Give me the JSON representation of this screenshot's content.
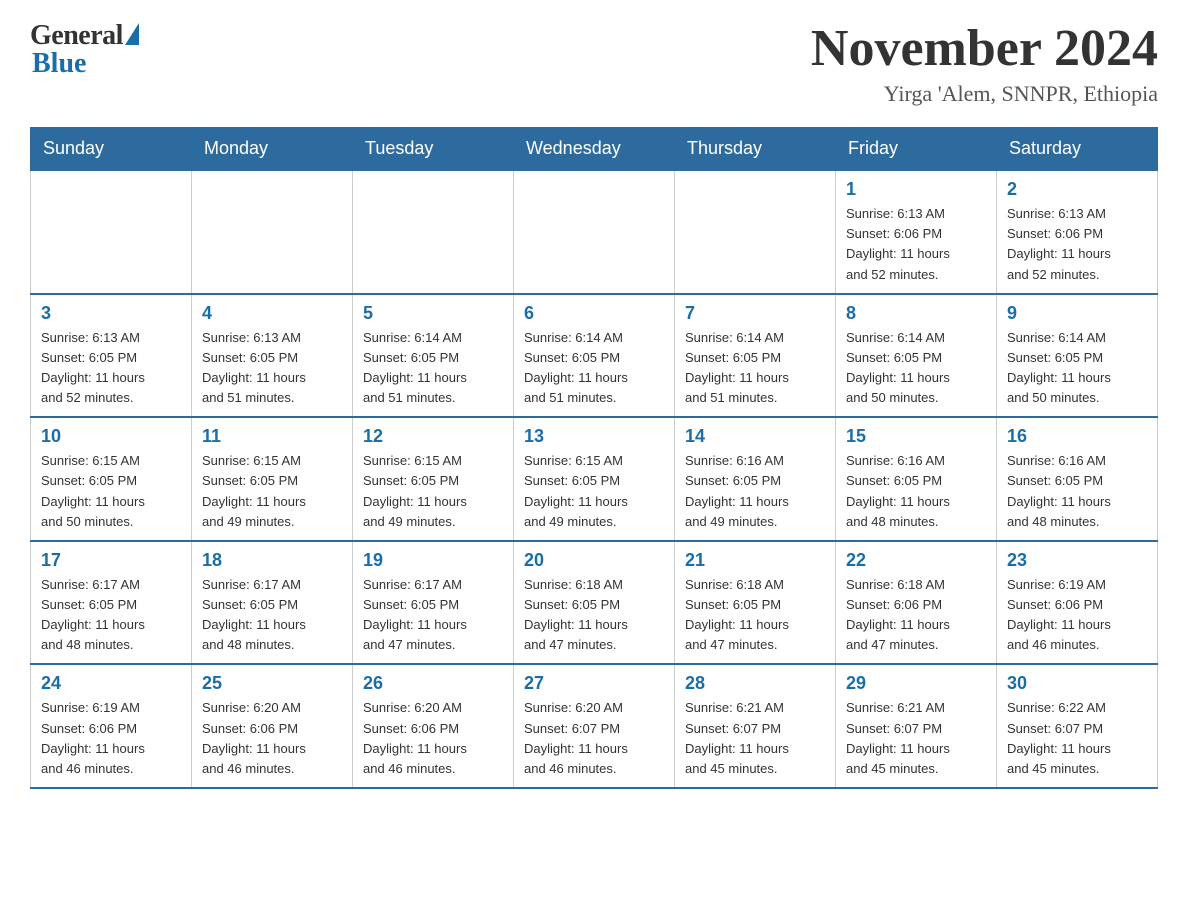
{
  "logo": {
    "general": "General",
    "blue": "Blue"
  },
  "header": {
    "title": "November 2024",
    "location": "Yirga 'Alem, SNNPR, Ethiopia"
  },
  "days_of_week": [
    "Sunday",
    "Monday",
    "Tuesday",
    "Wednesday",
    "Thursday",
    "Friday",
    "Saturday"
  ],
  "weeks": [
    [
      {
        "day": "",
        "info": ""
      },
      {
        "day": "",
        "info": ""
      },
      {
        "day": "",
        "info": ""
      },
      {
        "day": "",
        "info": ""
      },
      {
        "day": "",
        "info": ""
      },
      {
        "day": "1",
        "info": "Sunrise: 6:13 AM\nSunset: 6:06 PM\nDaylight: 11 hours\nand 52 minutes."
      },
      {
        "day": "2",
        "info": "Sunrise: 6:13 AM\nSunset: 6:06 PM\nDaylight: 11 hours\nand 52 minutes."
      }
    ],
    [
      {
        "day": "3",
        "info": "Sunrise: 6:13 AM\nSunset: 6:05 PM\nDaylight: 11 hours\nand 52 minutes."
      },
      {
        "day": "4",
        "info": "Sunrise: 6:13 AM\nSunset: 6:05 PM\nDaylight: 11 hours\nand 51 minutes."
      },
      {
        "day": "5",
        "info": "Sunrise: 6:14 AM\nSunset: 6:05 PM\nDaylight: 11 hours\nand 51 minutes."
      },
      {
        "day": "6",
        "info": "Sunrise: 6:14 AM\nSunset: 6:05 PM\nDaylight: 11 hours\nand 51 minutes."
      },
      {
        "day": "7",
        "info": "Sunrise: 6:14 AM\nSunset: 6:05 PM\nDaylight: 11 hours\nand 51 minutes."
      },
      {
        "day": "8",
        "info": "Sunrise: 6:14 AM\nSunset: 6:05 PM\nDaylight: 11 hours\nand 50 minutes."
      },
      {
        "day": "9",
        "info": "Sunrise: 6:14 AM\nSunset: 6:05 PM\nDaylight: 11 hours\nand 50 minutes."
      }
    ],
    [
      {
        "day": "10",
        "info": "Sunrise: 6:15 AM\nSunset: 6:05 PM\nDaylight: 11 hours\nand 50 minutes."
      },
      {
        "day": "11",
        "info": "Sunrise: 6:15 AM\nSunset: 6:05 PM\nDaylight: 11 hours\nand 49 minutes."
      },
      {
        "day": "12",
        "info": "Sunrise: 6:15 AM\nSunset: 6:05 PM\nDaylight: 11 hours\nand 49 minutes."
      },
      {
        "day": "13",
        "info": "Sunrise: 6:15 AM\nSunset: 6:05 PM\nDaylight: 11 hours\nand 49 minutes."
      },
      {
        "day": "14",
        "info": "Sunrise: 6:16 AM\nSunset: 6:05 PM\nDaylight: 11 hours\nand 49 minutes."
      },
      {
        "day": "15",
        "info": "Sunrise: 6:16 AM\nSunset: 6:05 PM\nDaylight: 11 hours\nand 48 minutes."
      },
      {
        "day": "16",
        "info": "Sunrise: 6:16 AM\nSunset: 6:05 PM\nDaylight: 11 hours\nand 48 minutes."
      }
    ],
    [
      {
        "day": "17",
        "info": "Sunrise: 6:17 AM\nSunset: 6:05 PM\nDaylight: 11 hours\nand 48 minutes."
      },
      {
        "day": "18",
        "info": "Sunrise: 6:17 AM\nSunset: 6:05 PM\nDaylight: 11 hours\nand 48 minutes."
      },
      {
        "day": "19",
        "info": "Sunrise: 6:17 AM\nSunset: 6:05 PM\nDaylight: 11 hours\nand 47 minutes."
      },
      {
        "day": "20",
        "info": "Sunrise: 6:18 AM\nSunset: 6:05 PM\nDaylight: 11 hours\nand 47 minutes."
      },
      {
        "day": "21",
        "info": "Sunrise: 6:18 AM\nSunset: 6:05 PM\nDaylight: 11 hours\nand 47 minutes."
      },
      {
        "day": "22",
        "info": "Sunrise: 6:18 AM\nSunset: 6:06 PM\nDaylight: 11 hours\nand 47 minutes."
      },
      {
        "day": "23",
        "info": "Sunrise: 6:19 AM\nSunset: 6:06 PM\nDaylight: 11 hours\nand 46 minutes."
      }
    ],
    [
      {
        "day": "24",
        "info": "Sunrise: 6:19 AM\nSunset: 6:06 PM\nDaylight: 11 hours\nand 46 minutes."
      },
      {
        "day": "25",
        "info": "Sunrise: 6:20 AM\nSunset: 6:06 PM\nDaylight: 11 hours\nand 46 minutes."
      },
      {
        "day": "26",
        "info": "Sunrise: 6:20 AM\nSunset: 6:06 PM\nDaylight: 11 hours\nand 46 minutes."
      },
      {
        "day": "27",
        "info": "Sunrise: 6:20 AM\nSunset: 6:07 PM\nDaylight: 11 hours\nand 46 minutes."
      },
      {
        "day": "28",
        "info": "Sunrise: 6:21 AM\nSunset: 6:07 PM\nDaylight: 11 hours\nand 45 minutes."
      },
      {
        "day": "29",
        "info": "Sunrise: 6:21 AM\nSunset: 6:07 PM\nDaylight: 11 hours\nand 45 minutes."
      },
      {
        "day": "30",
        "info": "Sunrise: 6:22 AM\nSunset: 6:07 PM\nDaylight: 11 hours\nand 45 minutes."
      }
    ]
  ]
}
